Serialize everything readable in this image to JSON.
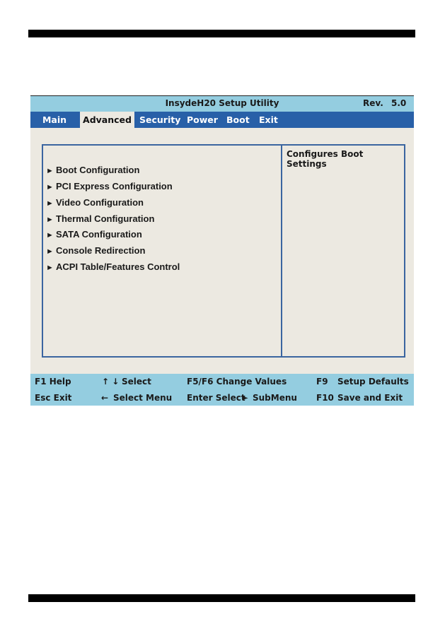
{
  "title": "InsydeH20 Setup Utility",
  "revision": {
    "label": "Rev.",
    "value": "5.0"
  },
  "menu_tabs": [
    {
      "label": "Main",
      "active": false
    },
    {
      "label": "Advanced",
      "active": true
    },
    {
      "label": "Security",
      "active": false
    },
    {
      "label": "Power",
      "active": false
    },
    {
      "label": "Boot",
      "active": false
    },
    {
      "label": "Exit",
      "active": false
    }
  ],
  "submenu_items": [
    {
      "label": "Boot Configuration",
      "icon": "triangle-right-icon"
    },
    {
      "label": "PCI Express Configuration",
      "icon": "triangle-right-icon"
    },
    {
      "label": "Video Configuration",
      "icon": "triangle-right-icon"
    },
    {
      "label": "Thermal Configuration",
      "icon": "triangle-right-icon"
    },
    {
      "label": "SATA Configuration",
      "icon": "triangle-right-icon"
    },
    {
      "label": "Console Redirection",
      "icon": "triangle-right-icon"
    },
    {
      "label": "ACPI Table/Features Control",
      "icon": "triangle-right-icon"
    }
  ],
  "help_text": "Configures Boot Settings",
  "footer": {
    "f1_help": "F1 Help",
    "esc_exit": "Esc Exit",
    "updown_icon": "↑ ↓",
    "updown_select": "Select",
    "left_icon": "←",
    "select_menu": "Select Menu",
    "f5f6": "F5/F6 Change Values",
    "enter_select": "Enter Select",
    "submenu_icon": "►",
    "submenu": "SubMenu",
    "f9_key": "F9",
    "f9_label": "Setup Defaults",
    "f10_key": "F10",
    "f10_label": "Save and Exit"
  }
}
